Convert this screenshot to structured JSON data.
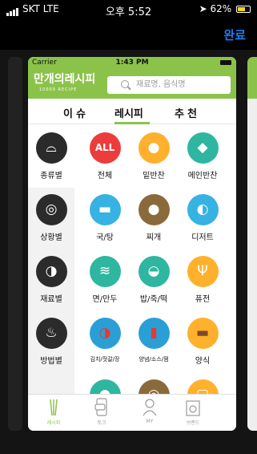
{
  "system_status": {
    "carrier": "SKT  LTE",
    "time": "오후 5:52",
    "battery": "62%"
  },
  "switcher": {
    "done_label": "완료"
  },
  "app": {
    "status": {
      "carrier": "Carrier",
      "time": "1:43 PM"
    },
    "logo": "만개의레시피",
    "logo_sub": "10000 RECIPE",
    "search_placeholder": "재료명, 음식명",
    "tabs": [
      {
        "label": "이슈"
      },
      {
        "label": "레시피"
      },
      {
        "label": "추천"
      }
    ],
    "active_tab": "레시피",
    "sidebar": [
      {
        "label": "종류별"
      },
      {
        "label": "상황별"
      },
      {
        "label": "재료별"
      },
      {
        "label": "방법별"
      }
    ],
    "categories": [
      {
        "label": "전체",
        "icon_text": "ALL"
      },
      {
        "label": "밑반찬"
      },
      {
        "label": "메인반찬"
      },
      {
        "label": "국/탕"
      },
      {
        "label": "찌개"
      },
      {
        "label": "디저트"
      },
      {
        "label": "면/만두"
      },
      {
        "label": "밥/죽/떡"
      },
      {
        "label": "퓨전"
      },
      {
        "label": "김치/젓갈/장"
      },
      {
        "label": "양념/소스/잼"
      },
      {
        "label": "양식"
      }
    ],
    "bottom_nav": [
      {
        "label": "레시피"
      },
      {
        "label": "토크"
      },
      {
        "label": "MY"
      },
      {
        "label": "브랜드"
      }
    ],
    "colors": {
      "brand_green": "#8bc34a",
      "accent_blue": "#1d7cf2"
    }
  }
}
